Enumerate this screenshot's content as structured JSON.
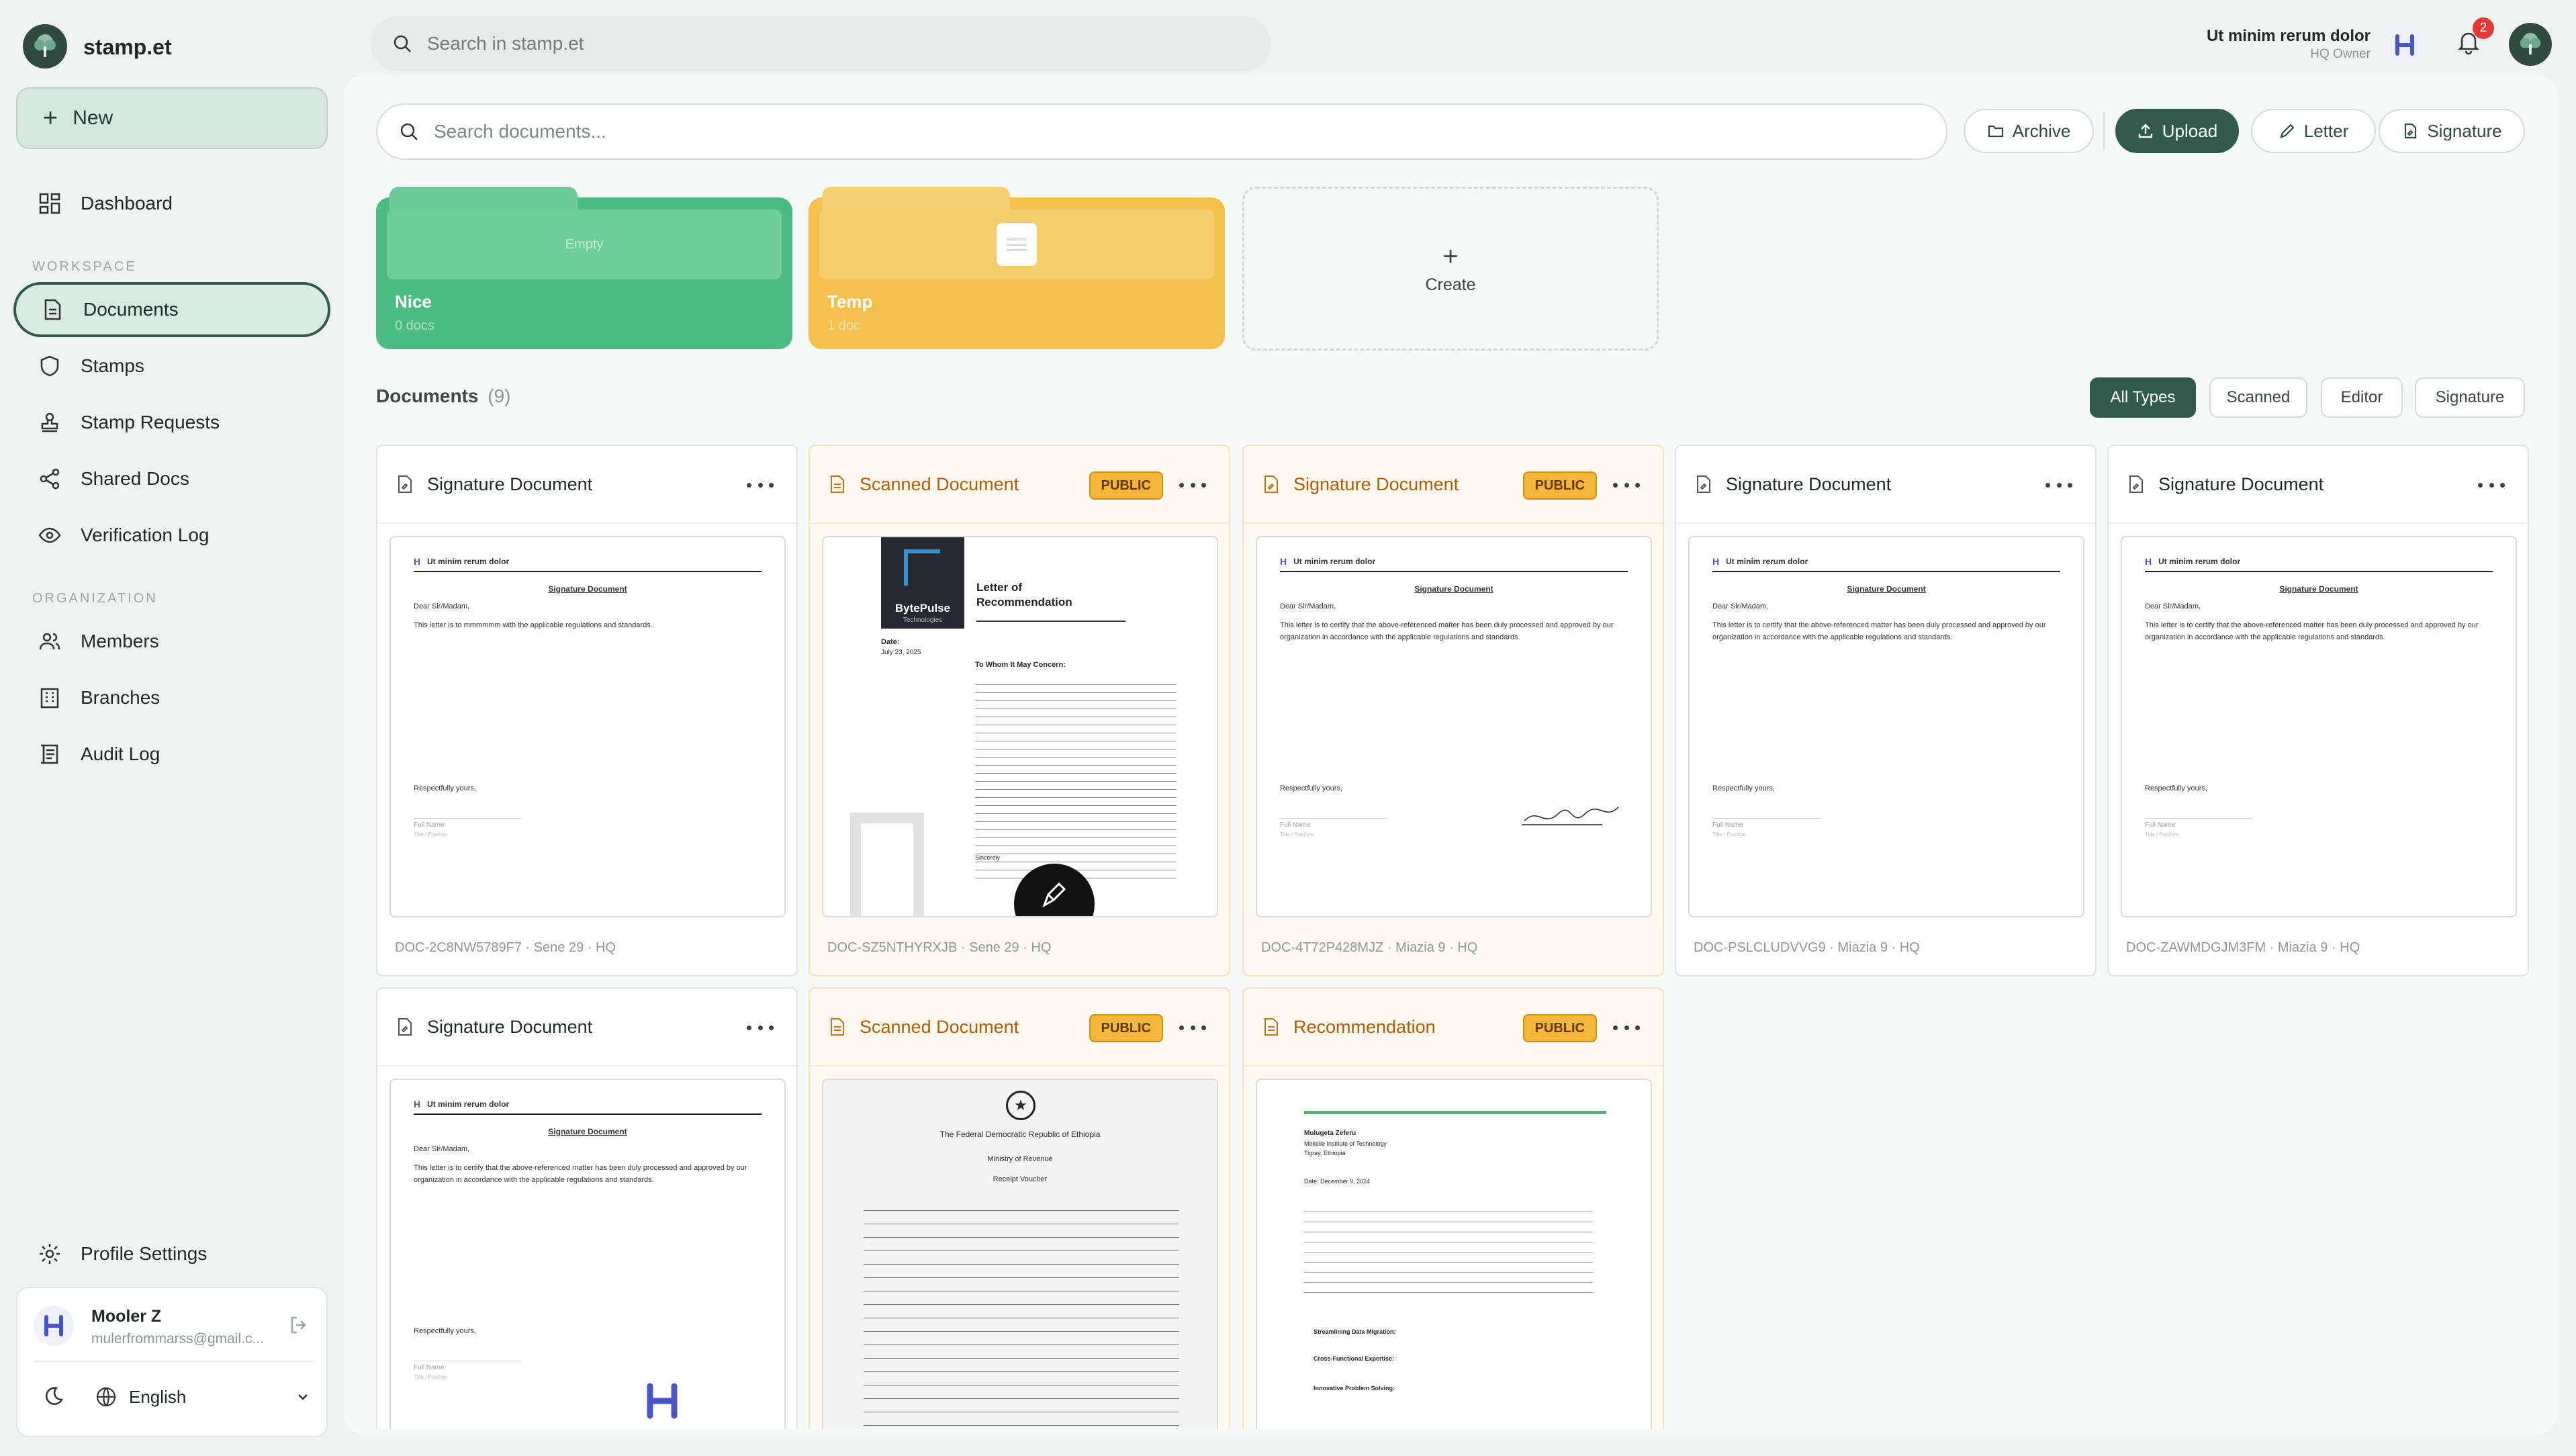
{
  "app": {
    "name": "stamp.et"
  },
  "topbar": {
    "search_placeholder": "Search in stamp.et",
    "user_name": "Ut minim rerum dolor",
    "user_role": "HQ Owner",
    "notifications_count": "2"
  },
  "sidebar": {
    "new_label": "New",
    "dashboard": "Dashboard",
    "workspace_label": "WORKSPACE",
    "workspace": [
      "Documents",
      "Stamps",
      "Stamp Requests",
      "Shared Docs",
      "Verification Log"
    ],
    "organization_label": "ORGANIZATION",
    "organization": [
      "Members",
      "Branches",
      "Audit Log"
    ],
    "profile_settings": "Profile Settings",
    "user": {
      "name": "Mooler Z",
      "email": "mulerfrommarss@gmail.c..."
    },
    "language": "English"
  },
  "toolbar": {
    "search_placeholder": "Search documents...",
    "archive": "Archive",
    "upload": "Upload",
    "letter": "Letter",
    "signature": "Signature"
  },
  "folders": [
    {
      "name": "Nice",
      "count": "0 docs",
      "empty_label": "Empty",
      "color": "#4dbb84"
    },
    {
      "name": "Temp",
      "count": "1 doc",
      "color": "#f3c04c"
    }
  ],
  "create_label": "Create",
  "documents": {
    "title": "Documents",
    "count": "(9)",
    "filters": [
      "All Types",
      "Scanned",
      "Editor",
      "Signature"
    ],
    "public_badge": "PUBLIC",
    "items": [
      {
        "title": "Signature Document",
        "footer": "DOC-2C8NW5789F7 · Sene 29 · HQ"
      },
      {
        "title": "Scanned Document",
        "footer": "DOC-SZ5NTHYRXJB · Sene 29 · HQ"
      },
      {
        "title": "Signature Document",
        "footer": "DOC-4T72P428MJZ · Miazia 9 · HQ"
      },
      {
        "title": "Signature Document",
        "footer": "DOC-PSLCLUDVVG9 · Miazia 9 · HQ"
      },
      {
        "title": "Signature Document",
        "footer": "DOC-ZAWMDGJM3FM · Miazia 9 · HQ"
      },
      {
        "title": "Signature Document"
      },
      {
        "title": "Scanned Document"
      },
      {
        "title": "Recommendation"
      }
    ]
  },
  "preview_letter": {
    "org": "Ut minim rerum dolor",
    "heading": "Signature Document",
    "salutation": "Dear Sir/Madam,",
    "body_short": "This letter is to mmmmmm with the applicable regulations and standards.",
    "body": "This letter is to certify that the above-referenced matter has been duly processed and approved by our organization in accordance with the applicable regulations and standards.",
    "closing": "Respectfully yours,",
    "full_name": "Full Name",
    "title_position": "Title / Position"
  },
  "scanned_letter": {
    "company": "BytePulse",
    "company_sub": "Technologies",
    "title": "Letter of Recommendation",
    "date_label": "Date:",
    "date": "July 23, 2025",
    "greeting": "To Whom It May Concern:",
    "closing": "Sincerely"
  },
  "receipt": {
    "l1": "The Federal Democratic Republic of Ethiopia",
    "l2": "Ministry of Revenue",
    "l3": "Receipt Voucher"
  },
  "recommendation": {
    "name": "Mulugeta Zeferu",
    "inst": "Mekelle Institute of Technology",
    "loc": "Tigray, Ethiopia",
    "date": "Date: December 9, 2024",
    "bullets": [
      "Streamlining Data Migration:",
      "Cross-Functional Expertise:",
      "Innovative Problem Solving:"
    ]
  }
}
